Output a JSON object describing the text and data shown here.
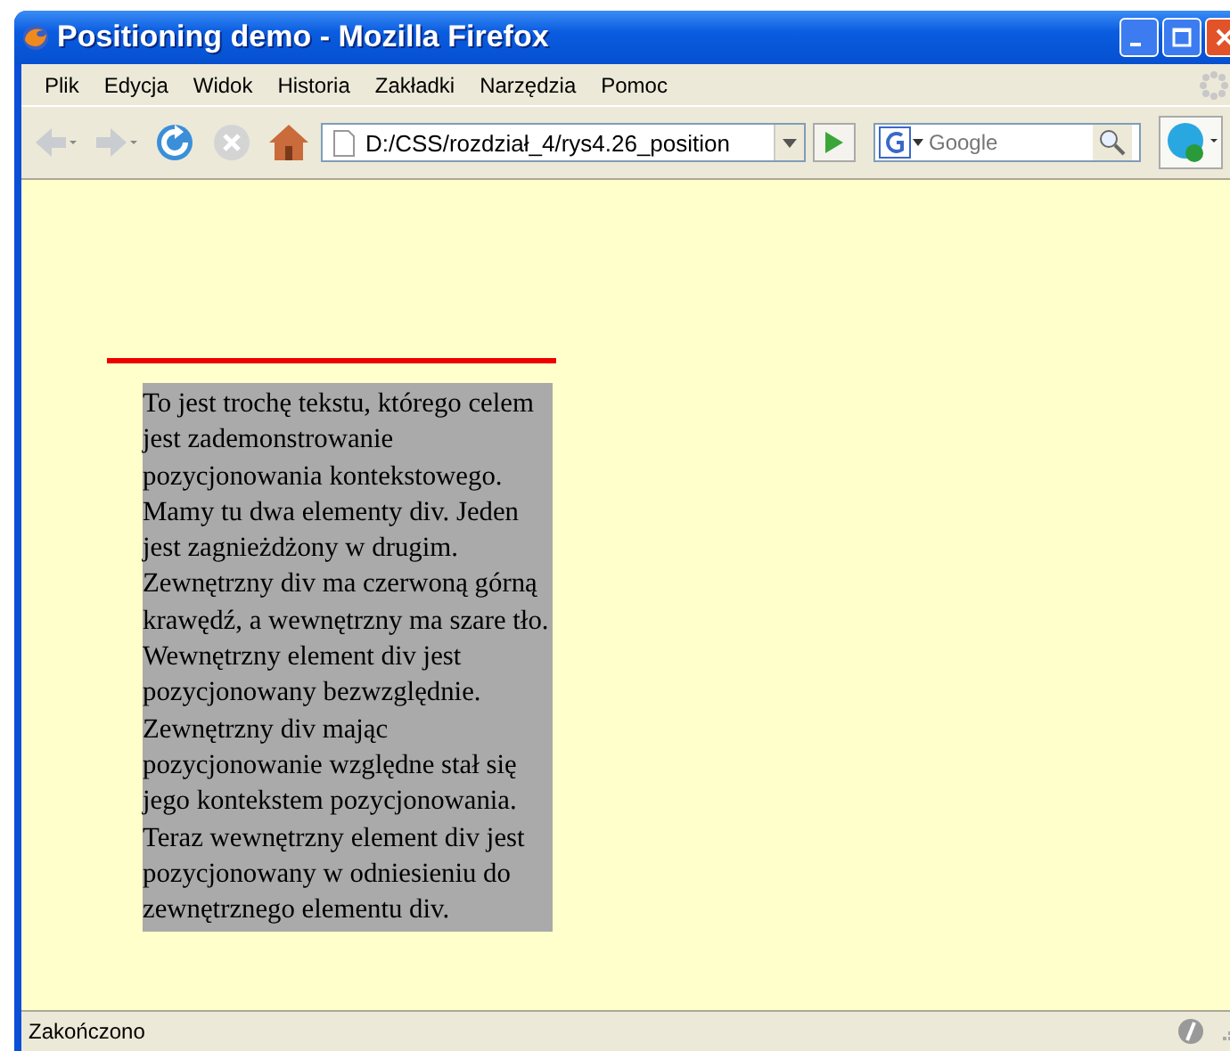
{
  "window": {
    "title": "Positioning demo - Mozilla Firefox"
  },
  "menu": [
    "Plik",
    "Edycja",
    "Widok",
    "Historia",
    "Zakładki",
    "Narzędzia",
    "Pomoc"
  ],
  "toolbar": {
    "address": "D:/CSS/rozdział_4/rys4.26_position",
    "search_placeholder": "Google"
  },
  "page": {
    "paragraph": "To jest trochę tekstu, którego celem jest zademonstrowanie pozycjonowania kontekstowego. Mamy tu dwa elementy div. Jeden jest zagnieżdżony w drugim. Zewnętrzny div ma czerwoną górną krawędź, a wewnętrzny ma szare tło. Wewnętrzny element div jest pozycjonowany bezwzględnie. Zewnętrzny div mając pozycjonowanie względne stał się jego kontekstem pozycjonowania. Teraz wewnętrzny element div jest pozycjonowany w odniesieniu do zewnętrznego elementu div."
  },
  "status_bar": {
    "text": "Zakończono"
  }
}
